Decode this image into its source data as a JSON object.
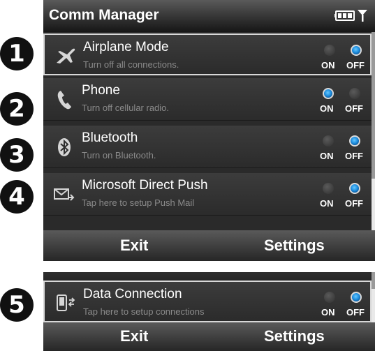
{
  "badges": [
    "1",
    "2",
    "3",
    "4",
    "5"
  ],
  "titlebar": {
    "title": "Comm Manager",
    "status_icons": [
      "battery-icon",
      "signal-icon"
    ]
  },
  "radio_labels": {
    "on": "ON",
    "off": "OFF"
  },
  "rows": [
    {
      "name": "Airplane Mode",
      "desc": "Turn off all connections.",
      "icon": "airplane-icon",
      "state": "off",
      "selected": true
    },
    {
      "name": "Phone",
      "desc": "Turn off cellular radio.",
      "icon": "phone-icon",
      "state": "on",
      "selected": false
    },
    {
      "name": "Bluetooth",
      "desc": "Turn on Bluetooth.",
      "icon": "bluetooth-icon",
      "state": "off",
      "selected": false
    },
    {
      "name": "Microsoft Direct Push",
      "desc": "Tap here to setup Push Mail",
      "icon": "mail-push-icon",
      "state": "off",
      "selected": false
    }
  ],
  "data_connection": {
    "name": "Data Connection",
    "desc": "Tap here to setup connections",
    "icon": "data-connection-icon",
    "state": "off",
    "selected": true
  },
  "softkeys": {
    "left": "Exit",
    "right": "Settings"
  },
  "colors": {
    "radio_selected": "#1f8fe0",
    "background": "#2a2a2a"
  }
}
